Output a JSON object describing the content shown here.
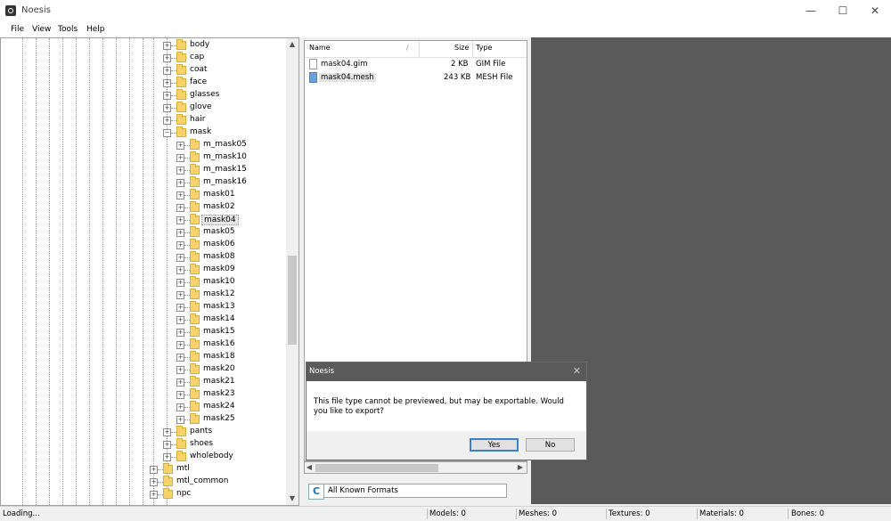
{
  "window": {
    "title": "Noesis",
    "controls": [
      "—",
      "☐",
      "✕"
    ]
  },
  "menu": [
    "File",
    "View",
    "Tools",
    "Help"
  ],
  "tree": {
    "level1": [
      "body",
      "cap",
      "coat",
      "face",
      "glasses",
      "glove",
      "hair",
      "mask"
    ],
    "mask_children": [
      "m_mask05",
      "m_mask10",
      "m_mask15",
      "m_mask16",
      "mask01",
      "mask02",
      "mask04",
      "mask05",
      "mask06",
      "mask08",
      "mask09",
      "mask10",
      "mask12",
      "mask13",
      "mask14",
      "mask15",
      "mask16",
      "mask18",
      "mask20",
      "mask21",
      "mask23",
      "mask24",
      "mask25"
    ],
    "level1_after": [
      "pants",
      "shoes",
      "wholebody"
    ],
    "level0": [
      "mtl",
      "mtl_common",
      "npc"
    ],
    "selected": "mask04"
  },
  "files": {
    "headers": {
      "name": "Name",
      "size": "Size",
      "type": "Type"
    },
    "rows": [
      {
        "name": "mask04.gim",
        "size": "2 KB",
        "type": "GIM File",
        "icon": "document-icon"
      },
      {
        "name": "mask04.mesh",
        "size": "243 KB",
        "type": "MESH File",
        "icon": "mesh-file-icon"
      }
    ]
  },
  "format_filter": {
    "value": "All Known Formats",
    "refresh": "C"
  },
  "dialog": {
    "title": "Noesis",
    "close": "✕",
    "message": "This file type cannot be previewed, but may be exportable. Would you like to export?",
    "yes": "Yes",
    "no": "No"
  },
  "status": {
    "loading": "Loading...",
    "models": "Models: 0",
    "meshes": "Meshes: 0",
    "textures": "Textures: 0",
    "materials": "Materials: 0",
    "bones": "Bones: 0"
  },
  "colors": {
    "preview_bg": "#5a5a5a",
    "dialog_titlebar": "#5a5a5a",
    "folder": "#f6d36b",
    "accent": "#3c7fd1"
  }
}
